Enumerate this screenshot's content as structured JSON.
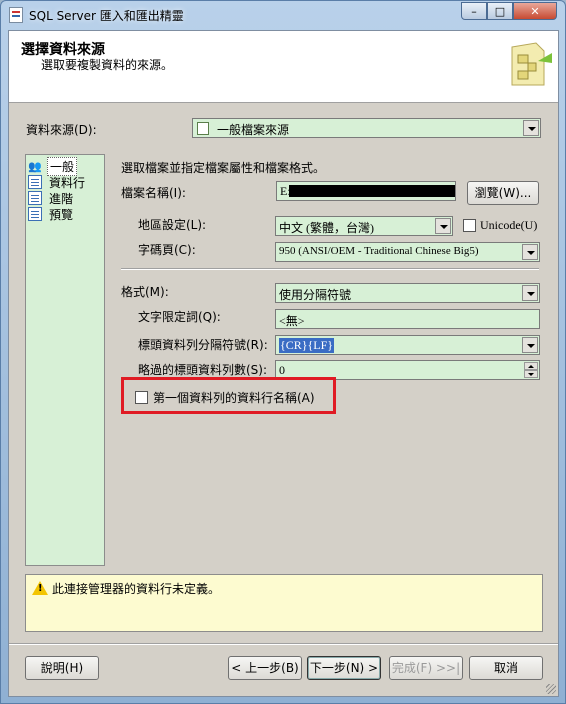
{
  "window": {
    "title": "SQL Server 匯入和匯出精靈",
    "min": "–",
    "max": "□",
    "close": "✕"
  },
  "header": {
    "title": "選擇資料來源",
    "subtitle": "選取要複製資料的來源。"
  },
  "datasource": {
    "label": "資料來源(D):",
    "value": "一般檔案來源"
  },
  "nav": {
    "items": [
      {
        "label": "一般",
        "icon": "general-icon",
        "selected": true
      },
      {
        "label": "資料行",
        "icon": "columns-icon",
        "selected": false
      },
      {
        "label": "進階",
        "icon": "advanced-icon",
        "selected": false
      },
      {
        "label": "預覽",
        "icon": "preview-icon",
        "selected": false
      }
    ]
  },
  "general": {
    "instruction": "選取檔案並指定檔案屬性和檔案格式。",
    "filename_label": "檔案名稱(I):",
    "filename_value": "E:\\",
    "browse": "瀏覽(W)...",
    "locale_label": "地區設定(L):",
    "locale_value": "中文 (繁體，台灣)",
    "unicode_label": "Unicode(U)",
    "codepage_label": "字碼頁(C):",
    "codepage_value": "950   (ANSI/OEM - Traditional Chinese Big5)",
    "format_label": "格式(M):",
    "format_value": "使用分隔符號",
    "text_qualifier_label": "文字限定詞(Q):",
    "text_qualifier_value": "<無>",
    "header_delim_label": "標頭資料列分隔符號(R):",
    "header_delim_value": "{CR}{LF}",
    "header_skip_label": "略過的標頭資料列數(S):",
    "header_skip_value": "0",
    "first_row_names_label": "第一個資料列的資料行名稱(A)"
  },
  "message": {
    "text": "此連接管理器的資料行未定義。"
  },
  "buttons": {
    "help": "說明(H)",
    "back": "< 上一步(B)",
    "next": "下一步(N) >",
    "finish": "完成(F) >>|",
    "cancel": "取消"
  }
}
